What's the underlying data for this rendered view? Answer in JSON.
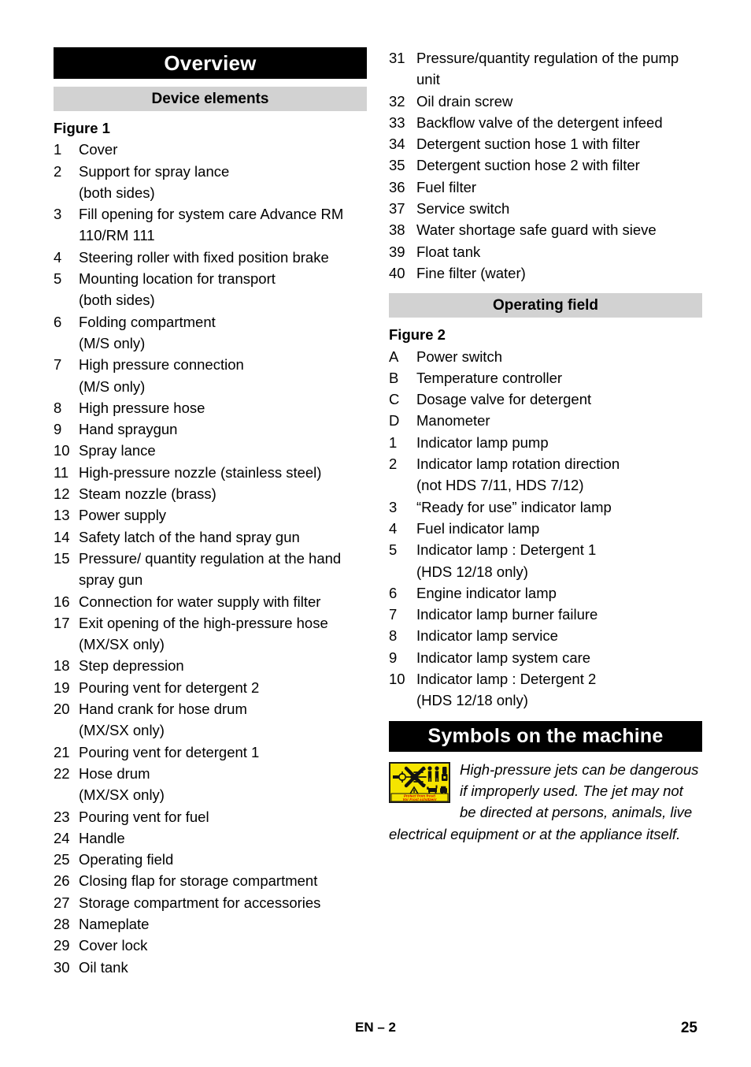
{
  "colors": {
    "section_bar_bg": "#000000",
    "section_bar_fg": "#ffffff",
    "subsection_bar_bg": "#d2d2d2",
    "sticker_yellow": "#f5e400",
    "sticker_red": "#d00000"
  },
  "left_column": {
    "section_title": "Overview",
    "subsection_title": "Device elements",
    "figure_label": "Figure 1",
    "items": [
      {
        "num": "1",
        "text": "Cover"
      },
      {
        "num": "2",
        "text": "Support for spray lance",
        "sub": "(both sides)"
      },
      {
        "num": "3",
        "text": "Fill opening for system care Advance RM 110/RM 111"
      },
      {
        "num": "4",
        "text": "Steering roller with fixed position brake"
      },
      {
        "num": "5",
        "text": "Mounting location for transport",
        "sub": "(both sides)"
      },
      {
        "num": "6",
        "text": "Folding compartment",
        "sub": "(M/S only)"
      },
      {
        "num": "7",
        "text": "High pressure connection",
        "sub": "(M/S only)"
      },
      {
        "num": "8",
        "text": "High pressure hose"
      },
      {
        "num": "9",
        "text": "Hand spraygun"
      },
      {
        "num": "10",
        "text": "Spray lance"
      },
      {
        "num": "11",
        "text": "High-pressure nozzle (stainless steel)"
      },
      {
        "num": "12",
        "text": "Steam nozzle (brass)"
      },
      {
        "num": "13",
        "text": "Power supply"
      },
      {
        "num": "14",
        "text": "Safety latch of the hand spray gun"
      },
      {
        "num": "15",
        "text": "Pressure/ quantity regulation at the hand spray gun"
      },
      {
        "num": "16",
        "text": "Connection for water supply with filter"
      },
      {
        "num": "17",
        "text": "Exit opening of the high-pressure hose",
        "sub": "(MX/SX only)"
      },
      {
        "num": "18",
        "text": "Step depression"
      },
      {
        "num": "19",
        "text": "Pouring vent for detergent 2"
      },
      {
        "num": "20",
        "text": "Hand crank for hose drum",
        "sub": "(MX/SX only)"
      },
      {
        "num": "21",
        "text": "Pouring vent for detergent 1"
      },
      {
        "num": "22",
        "text": "Hose drum",
        "sub": "(MX/SX only)"
      },
      {
        "num": "23",
        "text": "Pouring vent for fuel"
      },
      {
        "num": "24",
        "text": "Handle"
      },
      {
        "num": "25",
        "text": "Operating field"
      },
      {
        "num": "26",
        "text": "Closing flap for storage compartment"
      },
      {
        "num": "27",
        "text": "Storage compartment for accessories"
      },
      {
        "num": "28",
        "text": "Nameplate"
      },
      {
        "num": "29",
        "text": "Cover lock"
      },
      {
        "num": "30",
        "text": "Oil tank"
      }
    ]
  },
  "right_column": {
    "continued_items": [
      {
        "num": "31",
        "text": "Pressure/quantity regulation of the pump unit"
      },
      {
        "num": "32",
        "text": "Oil drain screw"
      },
      {
        "num": "33",
        "text": "Backflow valve of the detergent infeed"
      },
      {
        "num": "34",
        "text": "Detergent suction hose 1 with filter"
      },
      {
        "num": "35",
        "text": "Detergent suction hose 2 with filter"
      },
      {
        "num": "36",
        "text": "Fuel filter"
      },
      {
        "num": "37",
        "text": "Service switch"
      },
      {
        "num": "38",
        "text": "Water shortage safe guard with sieve"
      },
      {
        "num": "39",
        "text": "Float tank"
      },
      {
        "num": "40",
        "text": "Fine filter (water)"
      }
    ],
    "operating_field": {
      "subsection_title": "Operating field",
      "figure_label": "Figure 2",
      "items": [
        {
          "num": "A",
          "text": "Power switch"
        },
        {
          "num": "B",
          "text": "Temperature controller"
        },
        {
          "num": "C",
          "text": "Dosage valve for detergent"
        },
        {
          "num": "D",
          "text": "Manometer"
        },
        {
          "num": "1",
          "text": "Indicator lamp pump"
        },
        {
          "num": "2",
          "text": "Indicator lamp rotation direction",
          "sub": "(not HDS 7/11, HDS 7/12)"
        },
        {
          "num": "3",
          "text": "“Ready for use” indicator lamp"
        },
        {
          "num": "4",
          "text": "Fuel indicator lamp"
        },
        {
          "num": "5",
          "text": "Indicator lamp : Detergent 1",
          "sub": "(HDS 12/18 only)"
        },
        {
          "num": "6",
          "text": "Engine indicator lamp"
        },
        {
          "num": "7",
          "text": "Indicator lamp burner failure"
        },
        {
          "num": "8",
          "text": "Indicator lamp service"
        },
        {
          "num": "9",
          "text": "Indicator lamp system care"
        },
        {
          "num": "10",
          "text": "Indicator lamp : Detergent 2",
          "sub": "(HDS 12/18 only)"
        }
      ]
    },
    "symbols": {
      "section_title": "Symbols on the machine",
      "sticker": {
        "icon_name": "high-pressure-jet-warning-sticker",
        "line1": "Protect from frost!",
        "line2": "Vor Frost schützen!"
      },
      "body": "High-pressure jets can be dangerous if improperly used. The jet may not be directed at persons, animals, live electrical equipment or at the appliance itself."
    }
  },
  "footer": {
    "center": "EN – 2",
    "page_number": "25"
  }
}
